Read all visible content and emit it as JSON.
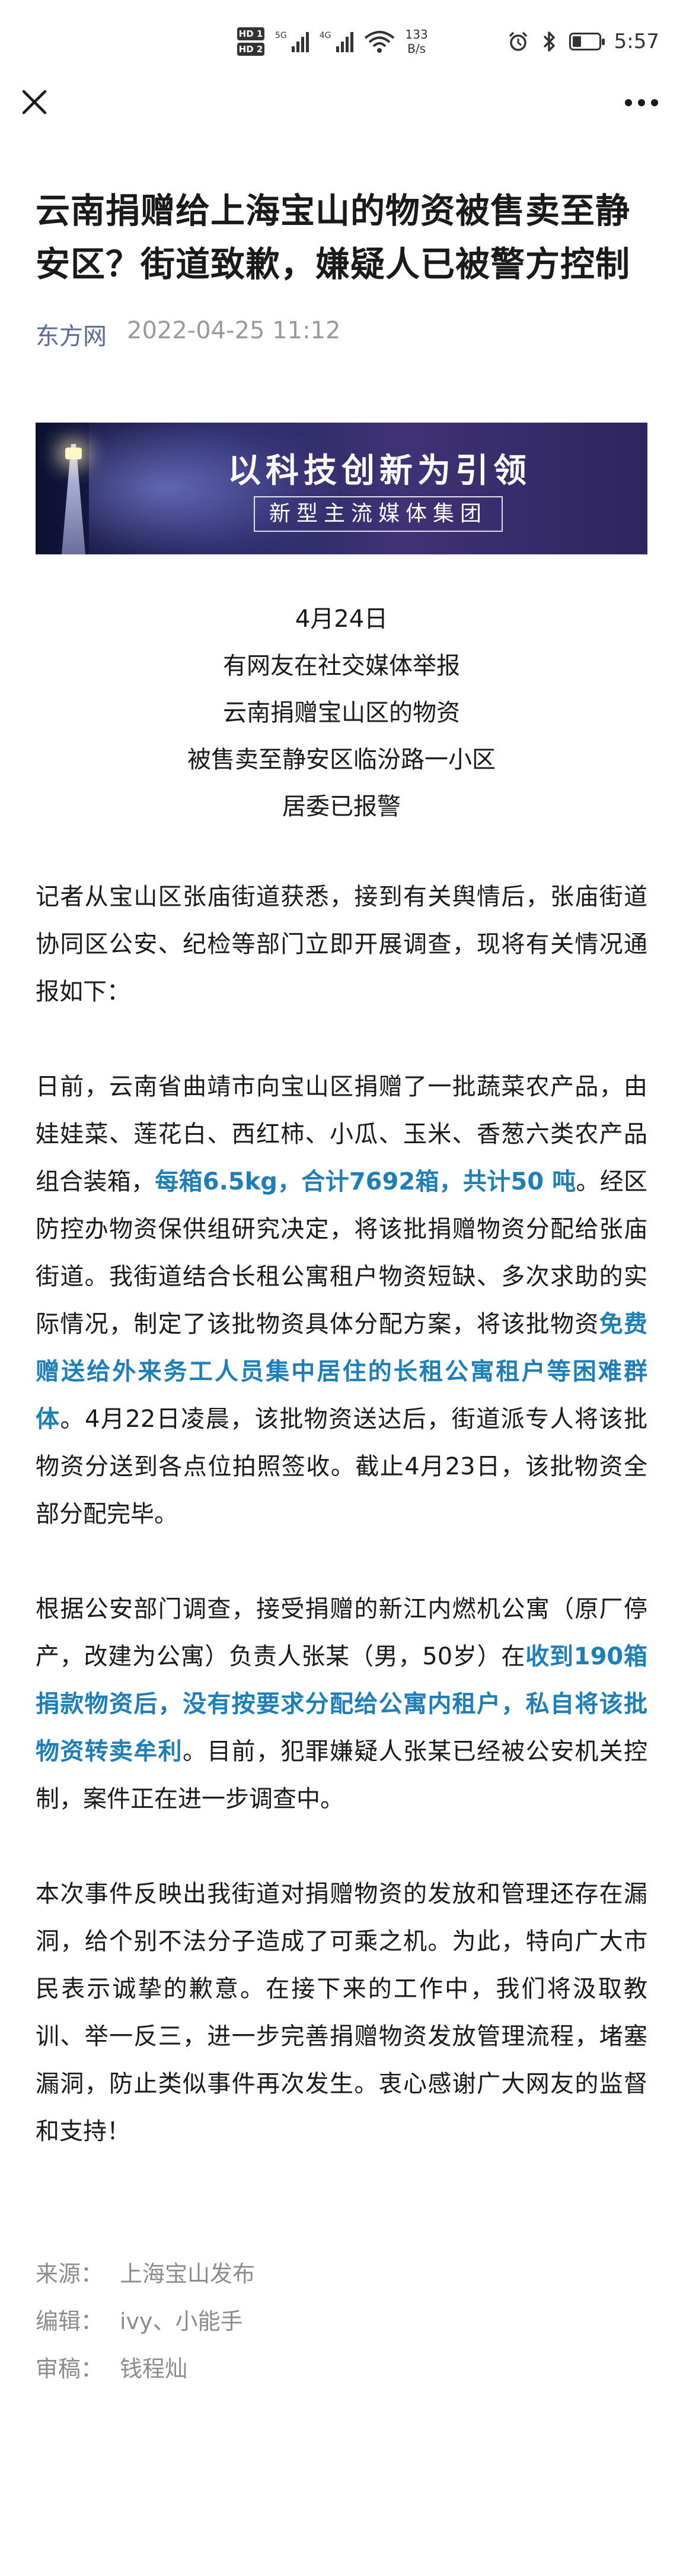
{
  "status_bar": {
    "hd1": "HD 1",
    "hd2": "HD 2",
    "sim1_label": "5G",
    "sim2_label": "4G",
    "speed_value": "133",
    "speed_unit": "B/s",
    "time": "5:57"
  },
  "article": {
    "title": "云南捐赠给上海宝山的物资被售卖至静安区？街道致歉，嫌疑人已被警方控制",
    "source": "东方网",
    "date": "2022-04-25 11:12",
    "banner": {
      "headline": "以科技创新为引领",
      "subline": "新型主流媒体集团"
    },
    "intro_lines": [
      "4月24日",
      "有网友在社交媒体举报",
      "云南捐赠宝山区的物资",
      "被售卖至静安区临汾路一小区",
      "居委已报警"
    ],
    "p1": "记者从宝山区张庙街道获悉，接到有关舆情后，张庙街道协同区公安、纪检等部门立即开展调查，现将有关情况通报如下：",
    "p2": {
      "a": "日前，云南省曲靖市向宝山区捐赠了一批蔬菜农产品，由娃娃菜、莲花白、西红柿、小瓜、玉米、香葱六类农产品组合装箱，",
      "b": "每箱6.5kg，合计7692箱，共计50 吨",
      "c": "。经区防控办物资保供组研究决定，将该批捐赠物资分配给张庙街道。我街道结合长租公寓租户物资短缺、多次求助的实际情况，制定了该批物资具体分配方案，将该批物资",
      "d": "免费赠送给外来务工人员集中居住的长租公寓租户等困难群体",
      "e": "。4月22日凌晨，该批物资送达后，街道派专人将该批物资分送到各点位拍照签收。截止4月23日，该批物资全部分配完毕。"
    },
    "p3": {
      "a": "根据公安部门调查，接受捐赠的新江内燃机公寓（原厂停产，改建为公寓）负责人张某（男，50岁）在",
      "b": "收到190箱捐款物资后，没有按要求分配给公寓内租户，私自将该批物资转卖牟利",
      "c": "。目前，犯罪嫌疑人张某已经被公安机关控制，案件正在进一步调查中。"
    },
    "p4": "本次事件反映出我街道对捐赠物资的发放和管理还存在漏洞，给个别不法分子造成了可乘之机。为此，特向广大市民表示诚挚的歉意。在接下来的工作中，我们将汲取教训、举一反三，进一步完善捐赠物资发放管理流程，堵塞漏洞，防止类似事件再次发生。衷心感谢广大网友的监督和支持！",
    "footer": {
      "source_label": "来源：",
      "source_value": "上海宝山发布",
      "editor_label": "编辑：",
      "editor_value": "ivy、小能手",
      "reviewer_label": "审稿：",
      "reviewer_value": "钱程灿"
    }
  },
  "colors": {
    "link": "#576b95",
    "highlight": "#1e7fb8",
    "meta_gray": "#9a9a9a"
  },
  "icons": [
    "close-icon",
    "more-icon",
    "alarm-icon",
    "bluetooth-icon",
    "battery-icon",
    "wifi-icon",
    "signal-icon"
  ]
}
